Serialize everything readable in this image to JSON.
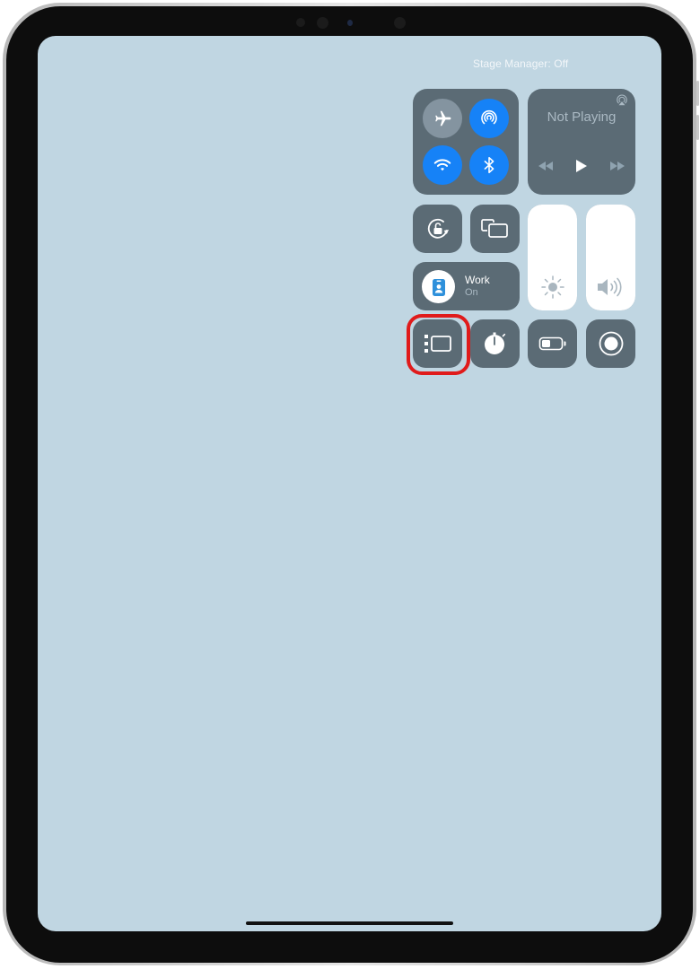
{
  "status_bar": {
    "stage_manager_status": "Stage Manager: Off"
  },
  "control_center": {
    "connectivity": {
      "airplane_mode": {
        "icon": "airplane-icon",
        "state": "off"
      },
      "airdrop": {
        "icon": "airdrop-icon",
        "state": "on"
      },
      "wifi": {
        "icon": "wifi-icon",
        "state": "on"
      },
      "bluetooth": {
        "icon": "bluetooth-icon",
        "state": "on"
      }
    },
    "now_playing": {
      "title": "Not Playing",
      "airplay_icon": "airplay-icon",
      "controls": [
        "rewind-icon",
        "play-icon",
        "fast-forward-icon"
      ]
    },
    "rotation_lock": {
      "icon": "rotation-lock-icon"
    },
    "screen_mirroring": {
      "icon": "screen-mirroring-icon"
    },
    "focus": {
      "mode": "Work",
      "state": "On",
      "icon": "work-badge-icon"
    },
    "brightness": {
      "icon": "sun-icon",
      "level_percent": 100
    },
    "volume": {
      "icon": "speaker-icon",
      "level_percent": 100
    },
    "stage_manager": {
      "icon": "stage-manager-icon",
      "highlighted": true
    },
    "timer": {
      "icon": "stopwatch-icon"
    },
    "low_power_mode": {
      "icon": "battery-icon"
    },
    "screen_recording": {
      "icon": "record-icon"
    }
  },
  "colors": {
    "wallpaper": "#c0d6e2",
    "tile": "#5b6b75",
    "active_blue": "#1682f7",
    "highlight_red": "#e01b1b"
  }
}
